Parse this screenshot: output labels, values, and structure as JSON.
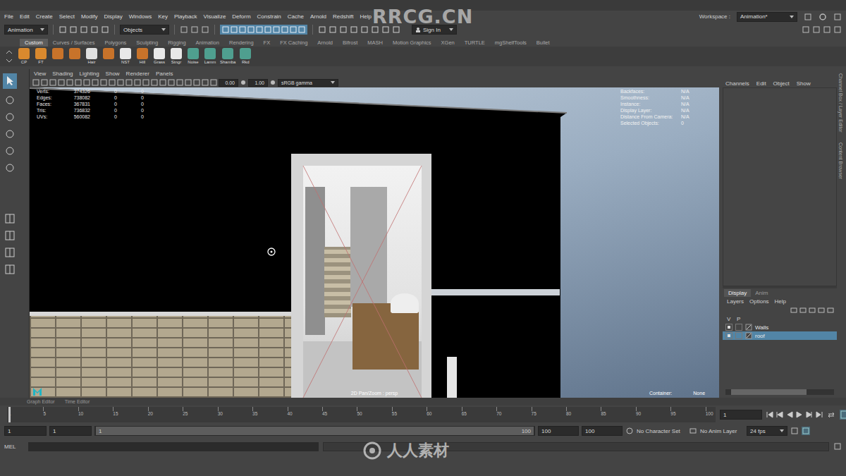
{
  "watermark": {
    "top": "RRCG.CN",
    "bottom": "人人素材"
  },
  "menu": [
    "File",
    "Edit",
    "Create",
    "Select",
    "Modify",
    "Display",
    "Windows",
    "Key",
    "Playback",
    "Visualize",
    "Deform",
    "Constrain",
    "Cache",
    "Arnold",
    "Redshift",
    "Help"
  ],
  "workspace": {
    "label": "Workspace :",
    "value": "Animation*"
  },
  "status_line": {
    "mode": "Animation",
    "selection": "Objects",
    "sign_in": "Sign In"
  },
  "shelf": {
    "tabs": [
      {
        "label": "Custom",
        "selected": true
      },
      {
        "label": "Curves / Surfaces",
        "selected": false
      },
      {
        "label": "Polygons",
        "selected": false
      },
      {
        "label": "Sculpting",
        "selected": false
      },
      {
        "label": "Rigging",
        "selected": false
      },
      {
        "label": "Animation",
        "selected": false
      },
      {
        "label": "Rendering",
        "selected": false
      },
      {
        "label": "FX",
        "selected": false
      },
      {
        "label": "FX Caching",
        "selected": false
      },
      {
        "label": "Arnold",
        "selected": false
      },
      {
        "label": "Bifrost",
        "selected": false
      },
      {
        "label": "MASH",
        "selected": false
      },
      {
        "label": "Motion Graphics",
        "selected": false
      },
      {
        "label": "XGen",
        "selected": false
      },
      {
        "label": "TURTLE",
        "selected": false
      },
      {
        "label": "mgShelfTools",
        "selected": false
      },
      {
        "label": "Bullet",
        "selected": false
      }
    ],
    "buttons": [
      {
        "label": "CP",
        "color": "#d9892e"
      },
      {
        "label": "FT",
        "color": "#d9892e"
      },
      {
        "label": "",
        "color": "#c8732a"
      },
      {
        "label": "",
        "color": "#c8732a"
      },
      {
        "label": "Hair",
        "color": "#e0e0e0"
      },
      {
        "label": "",
        "color": "#c8732a"
      },
      {
        "label": "NST",
        "color": "#e8e8e8"
      },
      {
        "label": "Hill",
        "color": "#c8732a"
      },
      {
        "label": "Grass",
        "color": "#e8e8e8"
      },
      {
        "label": "Stngr",
        "color": "#e8e8e8"
      },
      {
        "label": "Noise",
        "color": "#4f9f8f"
      },
      {
        "label": "Lamm",
        "color": "#4f9f8f"
      },
      {
        "label": "Shamba",
        "color": "#4f9f8f"
      },
      {
        "label": "Rkd",
        "color": "#4f9f8f"
      }
    ]
  },
  "viewport": {
    "menu": [
      "View",
      "Shading",
      "Lighting",
      "Show",
      "Renderer",
      "Panels"
    ],
    "fields": [
      "0.00",
      "1.00"
    ],
    "color_space": "sRGB gamma",
    "stats": [
      {
        "label": "Verts:",
        "values": [
          "374326",
          "0",
          "0"
        ]
      },
      {
        "label": "Edges:",
        "values": [
          "738082",
          "0",
          "0"
        ]
      },
      {
        "label": "Faces:",
        "values": [
          "367831",
          "0",
          "0"
        ]
      },
      {
        "label": "Tris:",
        "values": [
          "736832",
          "0",
          "0"
        ]
      },
      {
        "label": "UVs:",
        "values": [
          "560082",
          "0",
          "0"
        ]
      }
    ],
    "info": [
      {
        "label": "Backfaces:",
        "value": "N/A"
      },
      {
        "label": "Smoothness:",
        "value": "N/A"
      },
      {
        "label": "Instance:",
        "value": "N/A"
      },
      {
        "label": "Display Layer:",
        "value": "N/A"
      },
      {
        "label": "Distance From Camera:",
        "value": "N/A"
      },
      {
        "label": "Selected Objects:",
        "value": "0"
      }
    ],
    "camera": "2D Pan/Zoom : persp",
    "container": {
      "label": "Container:",
      "value": "None"
    }
  },
  "channel_box": {
    "menu": [
      "Channels",
      "Edit",
      "Object",
      "Show"
    ]
  },
  "side_tabs": [
    "Channel Box / Layer Editor",
    "Content Browser"
  ],
  "layer_editor": {
    "tabs": [
      {
        "label": "Display",
        "selected": true
      },
      {
        "label": "Anim",
        "selected": false
      }
    ],
    "menu": [
      "Layers",
      "Options",
      "Help"
    ],
    "columns": [
      "V",
      "P"
    ],
    "layers": [
      {
        "name": "Walls",
        "visible": true,
        "selected": false
      },
      {
        "name": "roof",
        "visible": true,
        "selected": true
      }
    ]
  },
  "bottom_tabs": [
    "Graph Editor",
    "Time Editor"
  ],
  "timeline": {
    "ticks": [
      "1",
      "5",
      "10",
      "15",
      "20",
      "25",
      "30",
      "35",
      "40",
      "45",
      "50",
      "55",
      "60",
      "65",
      "70",
      "75",
      "80",
      "85",
      "90",
      "95",
      "100"
    ],
    "current": "1"
  },
  "range": {
    "start": "1",
    "inner_start": "1",
    "slider_start": "1",
    "slider_end": "100",
    "inner_end": "100",
    "end": "100",
    "character_set": "No Character Set",
    "anim_layer": "No Anim Layer",
    "fps": "24 fps"
  },
  "command_line": {
    "label": "MEL"
  }
}
